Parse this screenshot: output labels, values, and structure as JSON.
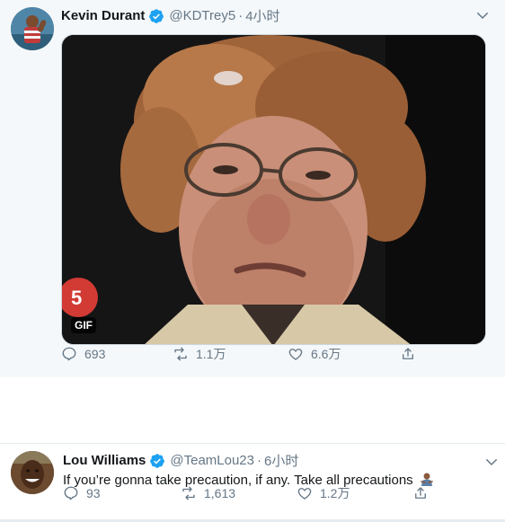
{
  "tweets": [
    {
      "name": "Kevin Durant",
      "handle": "@KDTrey5",
      "separator": "·",
      "time": "4小时",
      "media_badge": "GIF",
      "replies": "693",
      "retweets": "1.1万",
      "likes": "6.6万"
    },
    {
      "name": "Lou Williams",
      "handle": "@TeamLou23",
      "separator": "·",
      "time": "6小时",
      "text": "If you’re gonna take precaution, if any. Take all precautions",
      "replies": "93",
      "retweets": "1,613",
      "likes": "1.2万"
    }
  ],
  "colors": {
    "verified": "#1da1f2",
    "secondary_text": "#657786",
    "tweet_background": "#f5f8fa"
  },
  "icons": [
    "verified-badge-icon",
    "chevron-down-icon",
    "reply-icon",
    "retweet-icon",
    "like-icon",
    "share-icon",
    "person-gesturing-emoji-icon"
  ]
}
